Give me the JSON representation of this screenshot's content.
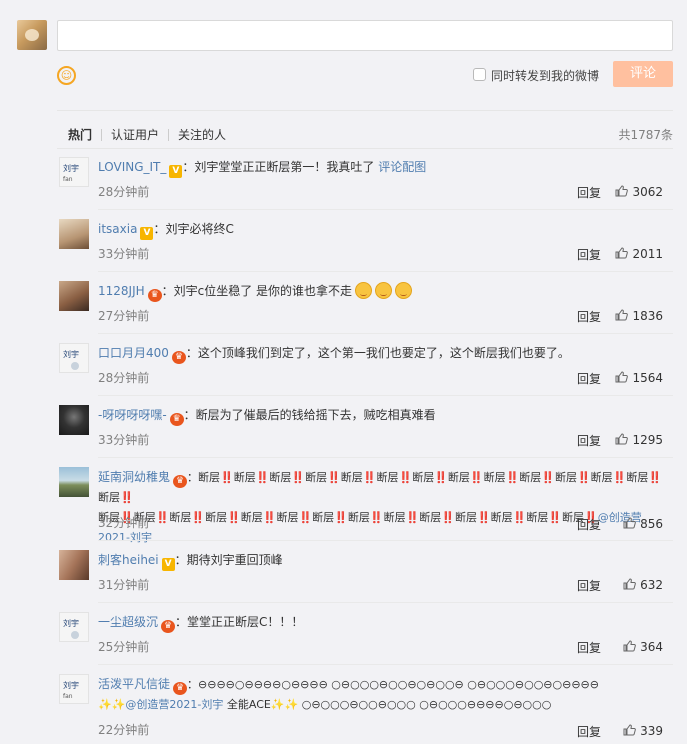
{
  "composer": {
    "forward_label": "同时转发到我的微博",
    "submit_label": "评论",
    "emoji_icon": "smile-icon"
  },
  "filter": {
    "tabs": [
      "热门",
      "认证用户",
      "关注的人"
    ],
    "total": "共1787条"
  },
  "comments": [
    {
      "user": "LOVING_IT_",
      "badge": "V",
      "text": "：刘宇堂堂正正断层第一！我真吐了",
      "link": "评论配图",
      "time": "28分钟前",
      "reply": "回复",
      "likes": "3062"
    },
    {
      "user": "itsaxia",
      "badge": "V",
      "text": "：刘宇必将终C",
      "time": "33分钟前",
      "reply": "回复",
      "likes": "2011"
    },
    {
      "user": "1128JJH",
      "badge": "crown",
      "text": "：刘宇c位坐稳了 是你的谁也拿不走",
      "time": "27分钟前",
      "reply": "回复",
      "likes": "1836"
    },
    {
      "user": "口口月月400",
      "badge": "crown",
      "text": "：这个顶峰我们到定了，这个第一我们也要定了，这个断层我们也要了。",
      "time": "28分钟前",
      "reply": "回复",
      "likes": "1564"
    },
    {
      "user": "-呀呀呀呀嘿-",
      "badge": "crown",
      "text": "：断层为了催最后的钱给摇下去，贼吃相真难看",
      "time": "33分钟前",
      "reply": "回复",
      "likes": "1295"
    },
    {
      "user": "延南洞幼稚鬼",
      "badge": "crown",
      "text_line1": "：断层‼️断层‼️断层‼️断层‼️断层‼️断层‼️断层‼️断层‼️断层‼️断层‼️断层‼️断层‼️断层‼️断层‼️",
      "text_line2": "断层‼️断层‼️断层‼️断层‼️断层‼️断层‼️断层‼️断层‼️断层‼️断层‼️断层‼️断层‼️断层‼️断层‼️",
      "link": "@创造营2021-刘宇",
      "time": "32分钟前",
      "reply": "回复",
      "likes": "856"
    },
    {
      "user": "刺客heihei",
      "badge": "V",
      "text": "：期待刘宇重回顶峰",
      "time": "31分钟前",
      "reply": "回复",
      "likes": "632"
    },
    {
      "user": "一尘超级沉",
      "badge": "crown",
      "text": "：堂堂正正断层C！！！",
      "time": "25分钟前",
      "reply": "回复",
      "likes": "364"
    },
    {
      "user": "活泼平凡信徒",
      "badge": "crown",
      "text_line1": "：⊖⊖⊖⊖○⊖⊖⊖⊖○⊖⊖⊖⊖ ○⊖○○○⊖○○⊖○⊖○○⊖ ○⊖○○○⊖○○⊖○⊖⊖⊖⊖",
      "link": "@创造营2021-刘宇",
      "text_prefix2": "✨✨",
      "text_line2": " 全能ACE✨✨ ○⊖○○○⊖○○⊖○○○ ○⊖○○○⊖⊖⊖⊖○⊖○○○",
      "time": "22分钟前",
      "reply": "回复",
      "likes": "339"
    }
  ]
}
